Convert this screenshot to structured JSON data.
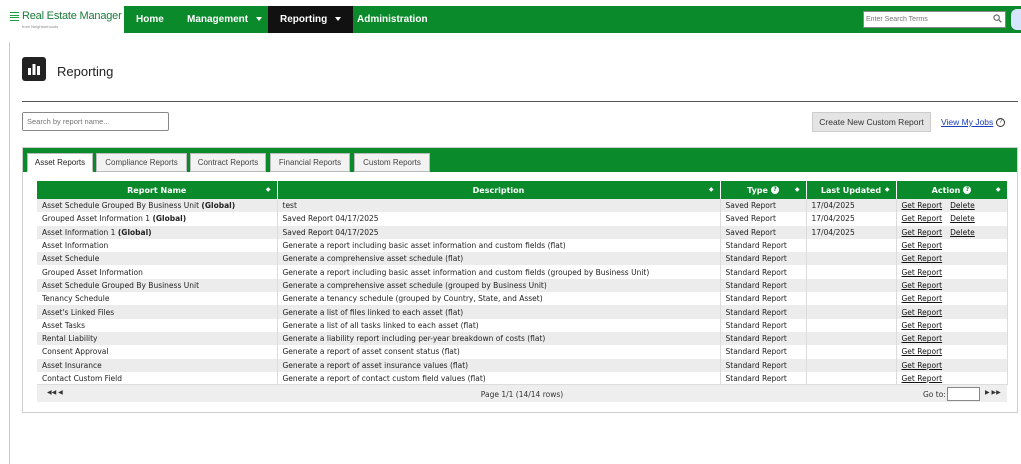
{
  "app": {
    "logo_title": "Real Estate Manager",
    "logo_sub": "from Neighborhoods"
  },
  "nav": {
    "items": [
      {
        "label": "Home"
      },
      {
        "label": "Management"
      },
      {
        "label": "Reporting"
      },
      {
        "label": "Administration"
      }
    ],
    "search_placeholder": "Enter Search Terms"
  },
  "page": {
    "title": "Reporting",
    "report_search_placeholder": "Search by report name...",
    "create_label": "Create New Custom Report",
    "view_jobs_label": "View My Jobs",
    "help_symbol": "?"
  },
  "tabs": [
    {
      "label": "Asset Reports"
    },
    {
      "label": "Compliance Reports"
    },
    {
      "label": "Contract Reports"
    },
    {
      "label": "Financial Reports"
    },
    {
      "label": "Custom Reports"
    }
  ],
  "table": {
    "headers": {
      "name": "Report Name",
      "description": "Description",
      "type": "Type",
      "updated": "Last Updated",
      "action": "Action"
    },
    "rows": [
      {
        "name": "Asset Schedule Grouped By Business Unit",
        "tag": "(Global)",
        "desc": "test",
        "type": "Saved Report",
        "updated": "17/04/2025",
        "get": "Get Report",
        "del": "Delete"
      },
      {
        "name": "Grouped Asset Information 1",
        "tag": "(Global)",
        "desc": "Saved Report 04/17/2025",
        "type": "Saved Report",
        "updated": "17/04/2025",
        "get": "Get Report",
        "del": "Delete"
      },
      {
        "name": "Asset Information 1",
        "tag": "(Global)",
        "desc": "Saved Report 04/17/2025",
        "type": "Saved Report",
        "updated": "17/04/2025",
        "get": "Get Report",
        "del": "Delete"
      },
      {
        "name": "Asset Information",
        "tag": "",
        "desc": "Generate a report including basic asset information and custom fields (flat)",
        "type": "Standard Report",
        "updated": "",
        "get": "Get Report",
        "del": ""
      },
      {
        "name": "Asset Schedule",
        "tag": "",
        "desc": "Generate a comprehensive asset schedule (flat)",
        "type": "Standard Report",
        "updated": "",
        "get": "Get Report",
        "del": ""
      },
      {
        "name": "Grouped Asset Information",
        "tag": "",
        "desc": "Generate a report including basic asset information and custom fields (grouped by Business Unit)",
        "type": "Standard Report",
        "updated": "",
        "get": "Get Report",
        "del": ""
      },
      {
        "name": "Asset Schedule Grouped By Business Unit",
        "tag": "",
        "desc": "Generate a comprehensive asset schedule (grouped by Business Unit)",
        "type": "Standard Report",
        "updated": "",
        "get": "Get Report",
        "del": ""
      },
      {
        "name": "Tenancy Schedule",
        "tag": "",
        "desc": "Generate a tenancy schedule (grouped by Country, State, and Asset)",
        "type": "Standard Report",
        "updated": "",
        "get": "Get Report",
        "del": ""
      },
      {
        "name": "Asset's Linked Files",
        "tag": "",
        "desc": "Generate a list of files linked to each asset (flat)",
        "type": "Standard Report",
        "updated": "",
        "get": "Get Report",
        "del": ""
      },
      {
        "name": "Asset Tasks",
        "tag": "",
        "desc": "Generate a list of all tasks linked to each asset (flat)",
        "type": "Standard Report",
        "updated": "",
        "get": "Get Report",
        "del": ""
      },
      {
        "name": "Rental Liability",
        "tag": "",
        "desc": "Generate a liability report including per-year breakdown of costs (flat)",
        "type": "Standard Report",
        "updated": "",
        "get": "Get Report",
        "del": ""
      },
      {
        "name": "Consent Approval",
        "tag": "",
        "desc": "Generate a report of asset consent status (flat)",
        "type": "Standard Report",
        "updated": "",
        "get": "Get Report",
        "del": ""
      },
      {
        "name": "Asset Insurance",
        "tag": "",
        "desc": "Generate a report of asset insurance values (flat)",
        "type": "Standard Report",
        "updated": "",
        "get": "Get Report",
        "del": ""
      },
      {
        "name": "Contact Custom Field",
        "tag": "",
        "desc": "Generate a report of contact custom field values (flat)",
        "type": "Standard Report",
        "updated": "",
        "get": "Get Report",
        "del": ""
      }
    ]
  },
  "pager": {
    "info": "Page 1/1 (14/14 rows)",
    "goto_label": "Go to:",
    "first_icon": "first-page-icon",
    "last_icon": "last-page-icon"
  },
  "colors": {
    "brand_green": "#0a8a2a",
    "nav_active": "#111111",
    "link_blue": "#1a3dbf"
  }
}
